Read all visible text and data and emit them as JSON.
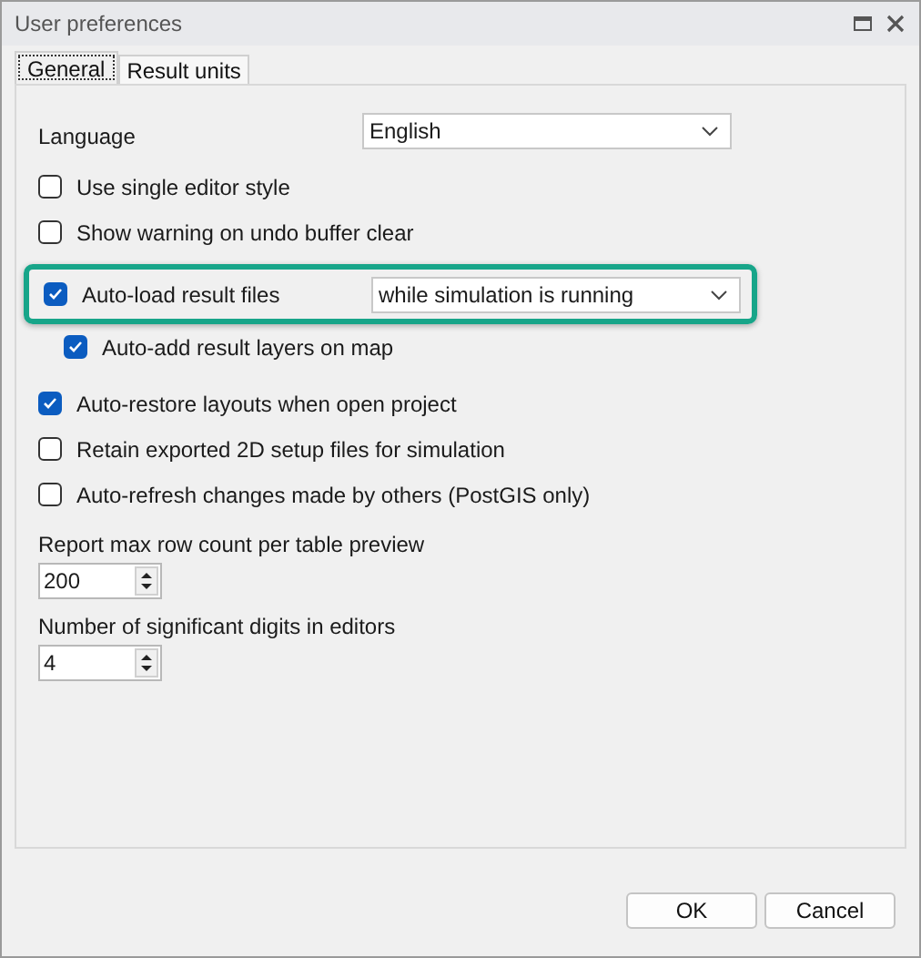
{
  "window": {
    "title": "User preferences"
  },
  "tabs": [
    {
      "label": "General",
      "selected": true
    },
    {
      "label": "Result units",
      "selected": false
    }
  ],
  "settings": [
    {
      "kind": "dropdown",
      "label": "Language",
      "value": "English"
    },
    {
      "kind": "checkbox",
      "label": "Use single editor style",
      "checked": false
    },
    {
      "kind": "checkbox",
      "label": "Show warning on undo buffer clear",
      "checked": false
    },
    {
      "kind": "checkbox-dropdown",
      "label": "Auto-load result files",
      "checked": true,
      "value": "while simulation is running",
      "highlighted": true
    },
    {
      "kind": "sub-checkbox",
      "label": "Auto-add result layers on map",
      "checked": true
    },
    {
      "kind": "checkbox",
      "label": "Auto-restore layouts when open project",
      "checked": true
    },
    {
      "kind": "checkbox",
      "label": "Retain exported 2D setup files for simulation",
      "checked": false
    },
    {
      "kind": "checkbox",
      "label": "Auto-refresh changes made by others (PostGIS only)",
      "checked": false
    },
    {
      "kind": "spinner",
      "label": "Report max row count per table preview",
      "value": "200"
    },
    {
      "kind": "spinner",
      "label": "Number of significant digits in editors",
      "value": "4"
    }
  ],
  "buttons": [
    "OK",
    "Cancel"
  ]
}
